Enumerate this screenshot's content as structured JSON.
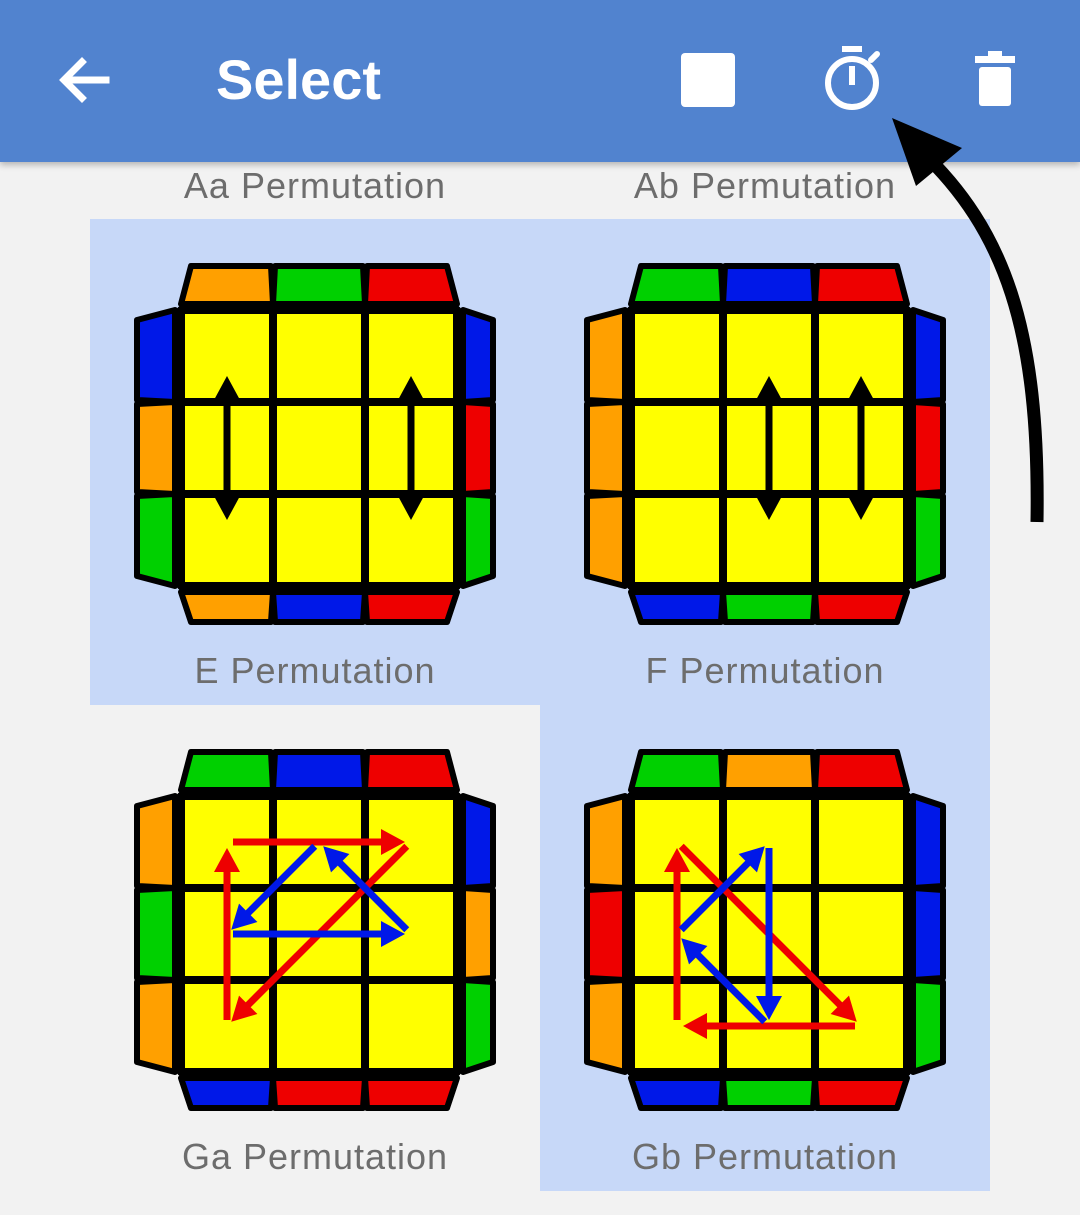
{
  "appbar": {
    "title": "Select",
    "back_icon": "arrow-back-icon",
    "select_all_icon": "square-icon",
    "timer_icon": "stopwatch-icon",
    "delete_icon": "trash-icon",
    "color": "#5183cf"
  },
  "top_labels": [
    "Aa Permutation",
    "Ab Permutation"
  ],
  "colors": {
    "yellow": "#ffff00",
    "orange": "#ffa000",
    "green": "#00d000",
    "red": "#ee0000",
    "blue": "#0018e8",
    "selection": "#c7d8f8"
  },
  "cases": [
    {
      "name": "E Permutation",
      "selected": true,
      "top": [
        "orange",
        "green",
        "red"
      ],
      "bottom": [
        "orange",
        "blue",
        "red"
      ],
      "left": [
        "blue",
        "orange",
        "green"
      ],
      "right": [
        "blue",
        "red",
        "green"
      ],
      "arrows": [
        {
          "from": [
            0,
            0
          ],
          "to": [
            2,
            0
          ],
          "color": "black",
          "double": true
        },
        {
          "from": [
            0,
            2
          ],
          "to": [
            2,
            2
          ],
          "color": "black",
          "double": true
        }
      ]
    },
    {
      "name": "F Permutation",
      "selected": true,
      "top": [
        "green",
        "blue",
        "red"
      ],
      "bottom": [
        "blue",
        "green",
        "red"
      ],
      "left": [
        "orange",
        "orange",
        "orange"
      ],
      "right": [
        "blue",
        "red",
        "green"
      ],
      "arrows": [
        {
          "from": [
            0,
            1
          ],
          "to": [
            2,
            1
          ],
          "color": "black",
          "double": true
        },
        {
          "from": [
            0,
            2
          ],
          "to": [
            2,
            2
          ],
          "color": "black",
          "double": true
        }
      ]
    },
    {
      "name": "Ga Permutation",
      "selected": false,
      "top": [
        "green",
        "blue",
        "red"
      ],
      "bottom": [
        "blue",
        "red",
        "red"
      ],
      "left": [
        "orange",
        "green",
        "orange"
      ],
      "right": [
        "blue",
        "orange",
        "green"
      ],
      "arrows": [
        {
          "from": [
            0,
            0
          ],
          "to": [
            0,
            2
          ],
          "color": "red"
        },
        {
          "from": [
            0,
            2
          ],
          "to": [
            2,
            0
          ],
          "color": "red"
        },
        {
          "from": [
            2,
            0
          ],
          "to": [
            0,
            0
          ],
          "color": "red"
        },
        {
          "from": [
            0,
            1
          ],
          "to": [
            1,
            0
          ],
          "color": "blue"
        },
        {
          "from": [
            1,
            0
          ],
          "to": [
            1,
            2
          ],
          "color": "blue"
        },
        {
          "from": [
            1,
            2
          ],
          "to": [
            0,
            1
          ],
          "color": "blue"
        }
      ]
    },
    {
      "name": "Gb Permutation",
      "selected": true,
      "top": [
        "green",
        "orange",
        "red"
      ],
      "bottom": [
        "blue",
        "green",
        "red"
      ],
      "left": [
        "orange",
        "red",
        "orange"
      ],
      "right": [
        "blue",
        "blue",
        "green"
      ],
      "arrows": [
        {
          "from": [
            0,
            0
          ],
          "to": [
            2,
            2
          ],
          "color": "red"
        },
        {
          "from": [
            2,
            2
          ],
          "to": [
            2,
            0
          ],
          "color": "red"
        },
        {
          "from": [
            2,
            0
          ],
          "to": [
            0,
            0
          ],
          "color": "red"
        },
        {
          "from": [
            1,
            0
          ],
          "to": [
            0,
            1
          ],
          "color": "blue"
        },
        {
          "from": [
            0,
            1
          ],
          "to": [
            2,
            1
          ],
          "color": "blue"
        },
        {
          "from": [
            2,
            1
          ],
          "to": [
            1,
            0
          ],
          "color": "blue"
        }
      ]
    }
  ]
}
